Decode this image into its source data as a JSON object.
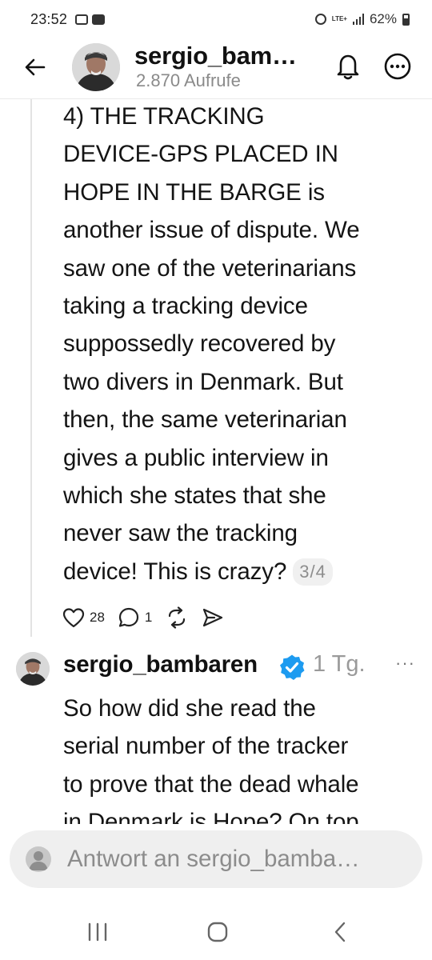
{
  "status_bar": {
    "time": "23:52",
    "battery_percent": "62%",
    "network": "LTE+",
    "icons": [
      "gallery-icon",
      "message-icon",
      "alarm-icon",
      "lte-icon",
      "signal-icon",
      "battery-icon"
    ]
  },
  "header": {
    "back_icon": "arrow-left-icon",
    "username": "sergio_bam…",
    "views": "2.870 Aufrufe",
    "bell_icon": "bell-icon",
    "more_icon": "more-horizontal-icon"
  },
  "post1": {
    "lines": [
      "4) THE TRACKING",
      "DEVICE-GPS PLACED IN",
      "HOPE IN THE BARGE is",
      "another issue of dispute. We",
      "saw one of the veterinarians",
      "taking a tracking device",
      "suppossedly recovered by",
      "two divers in Denmark. But",
      "then, the same veterinarian",
      "gives a public interview in",
      "which she states that she",
      "never saw the tracking",
      "device! This is crazy?"
    ],
    "page_indicator": "3/4",
    "likes": "28",
    "replies": "1"
  },
  "post2": {
    "username": "sergio_bambaren",
    "time": "1 Tg.",
    "more": "···",
    "lines": [
      "So how did she read the",
      "serial number of the tracker",
      "to prove that the dead whale",
      "in Denmark is Hope? On top"
    ]
  },
  "reply": {
    "placeholder": "Antwort an sergio_bamba…"
  },
  "colors": {
    "verified": "#1d9bf0",
    "muted_text": "#8a8a8a",
    "reply_bg": "#efefef"
  }
}
